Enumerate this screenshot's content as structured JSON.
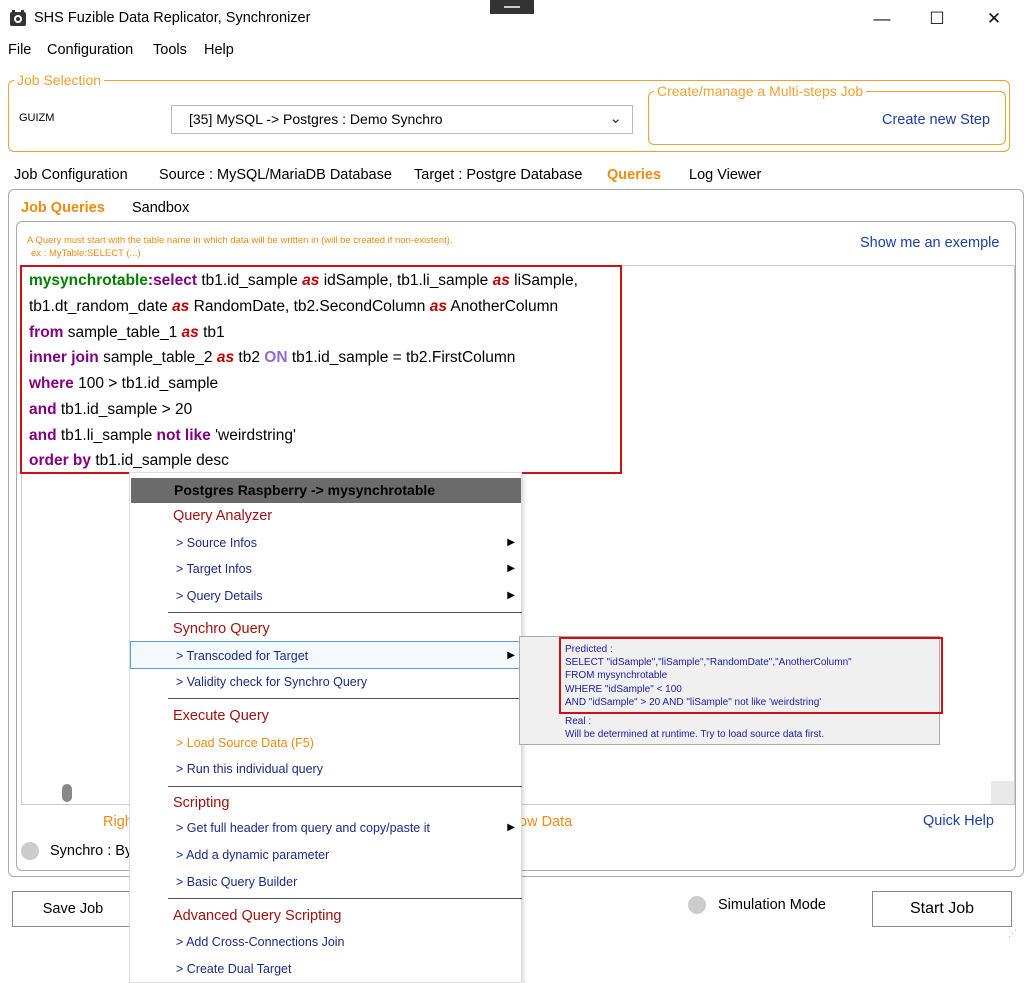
{
  "window": {
    "title": "SHS Fuzible Data Replicator, Synchronizer",
    "minimize": "—",
    "maximize": "☐",
    "close": "✕"
  },
  "menu": [
    "File",
    "Configuration",
    "Tools",
    "Help"
  ],
  "job_selection": {
    "legend": "Job Selection",
    "user": "GUIZM",
    "selected_job": "[35] MySQL -> Postgres : Demo Synchro"
  },
  "multi_steps": {
    "legend": "Create/manage a Multi-steps Job",
    "button": "Create new Step"
  },
  "tabs": [
    "Job Configuration",
    "Source : MySQL/MariaDB Database",
    "Target : Postgre Database",
    "Queries",
    "Log Viewer"
  ],
  "active_tab": "Queries",
  "subtabs": [
    "Job Queries",
    "Sandbox"
  ],
  "hint": {
    "line1": "A Query must start with the table name in which data will be written in (will be created if non-existent).",
    "line2": "ex : MyTable:SELECT (...)"
  },
  "show_example": "Show me an exemple",
  "query": {
    "table": "mysynchrotable",
    "colon": ":",
    "select": "select",
    "l1_a": "tb1.id_sample",
    "as": "as",
    "l1_b": "idSample, tb1.li_sample",
    "l1_c": "liSample,",
    "l2_a": "tb1.dt_random_date",
    "l2_b": "RandomDate, tb2.SecondColumn",
    "l2_c": "AnotherColumn",
    "from": "from",
    "l3_a": "sample_table_1",
    "l3_b": "tb1",
    "inner_join": "inner join",
    "l4_a": "sample_table_2",
    "l4_b": "tb2",
    "on": "ON",
    "l4_c": "tb1.id_sample = tb2.FirstColumn",
    "where": "where",
    "l5": "100 > tb1.id_sample",
    "and": "and",
    "l6": "tb1.id_sample > 20",
    "l7_a": "tb1.li_sample",
    "not_like": "not like",
    "l7_b": "'weirdstring'",
    "order_by": "order by",
    "l8": "tb1.id_sample desc"
  },
  "context_menu": {
    "header": "Postgres Raspberry -> mysynchrotable",
    "sections": {
      "query_analyzer": "Query Analyzer",
      "synchro_query": "Synchro Query",
      "execute_query": "Execute Query",
      "scripting": "Scripting",
      "advanced": "Advanced Query Scripting"
    },
    "items": {
      "source_infos": "> Source Infos",
      "target_infos": "> Target Infos",
      "query_details": "> Query Details",
      "transcoded": "> Transcoded for Target",
      "validity": "> Validity check for Synchro Query",
      "load_source": "> Load Source Data (F5)",
      "run_query": "> Run this individual query",
      "full_header": "> Get full header from query and copy/paste it",
      "dynamic_param": "> Add a dynamic parameter",
      "query_builder": "> Basic Query Builder",
      "cross_join": "> Add Cross-Connections Join",
      "dual_target": "> Create Dual Target"
    }
  },
  "tooltip": {
    "predicted": "Predicted :",
    "l1": "SELECT \"idSample\",\"liSample\",\"RandomDate\",\"AnotherColumn\"",
    "l2": "FROM mysynchrotable",
    "l3": "WHERE \"idSample\" < 100",
    "l4": "AND \"idSample\" > 20 AND \"liSample\" not like 'weirdstring'",
    "real": "Real :",
    "real_text": "Will be determined at runtime. Try to load source data first."
  },
  "bottom": {
    "left_fragment": "Righ",
    "right_fragment": "ow Data",
    "quick_help": "Quick Help",
    "synchro_label": "Synchro : By",
    "save_job": "Save Job",
    "simulation": "Simulation Mode",
    "start_job": "Start Job"
  },
  "colors": {
    "accent": "#f08a10",
    "link": "#1a3ea8",
    "highlight_border": "#d01010"
  }
}
